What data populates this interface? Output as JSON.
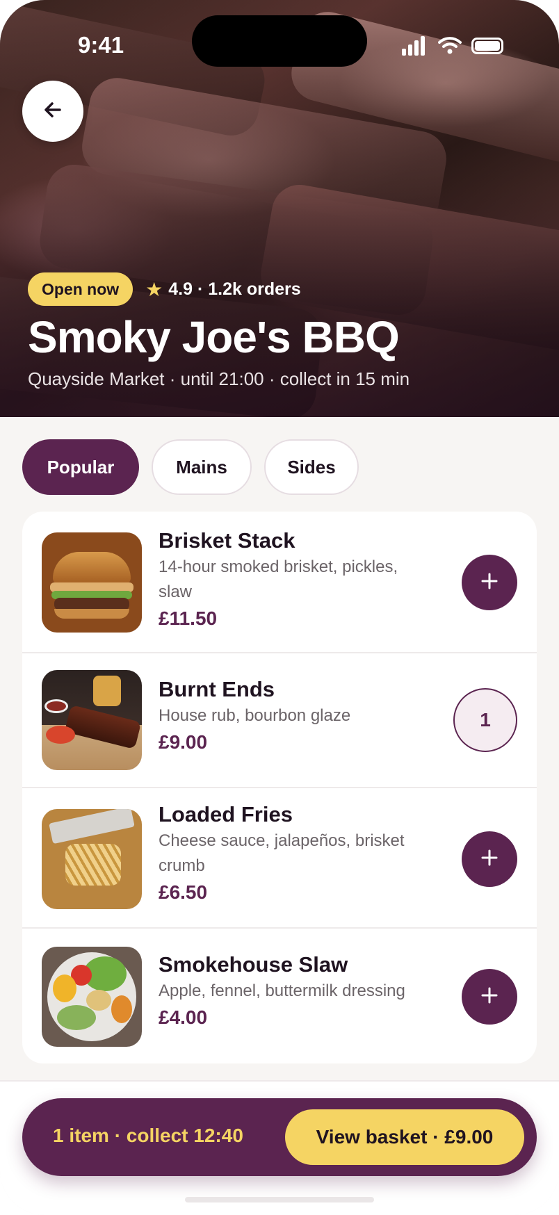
{
  "status_bar": {
    "time": "9:41"
  },
  "hero": {
    "badge": "Open now",
    "rating": "4.9 · 1.2k orders",
    "title": "Smoky Joe's BBQ",
    "subtitle": "Quayside Market · until 21:00 · collect in 15 min"
  },
  "tabs": [
    {
      "label": "Popular",
      "active": true
    },
    {
      "label": "Mains",
      "active": false
    },
    {
      "label": "Sides",
      "active": false
    }
  ],
  "menu_items": [
    {
      "name": "Brisket Stack",
      "desc_line1": "14-hour smoked brisket, pickles,",
      "desc_line2": "slaw",
      "price": "£11.50",
      "action": "add"
    },
    {
      "name": "Burnt Ends",
      "desc_line1": "House rub, bourbon glaze",
      "desc_line2": "",
      "price": "£9.00",
      "action": "quantity",
      "quantity": "1"
    },
    {
      "name": "Loaded Fries",
      "desc_line1": "Cheese sauce, jalapeños, brisket",
      "desc_line2": "crumb",
      "price": "£6.50",
      "action": "add"
    },
    {
      "name": "Smokehouse Slaw",
      "desc_line1": "Apple, fennel, buttermilk dressing",
      "desc_line2": "",
      "price": "£4.00",
      "action": "add"
    }
  ],
  "cart": {
    "summary": "1 item · collect 12:40",
    "button_label": "View basket · £9.00"
  },
  "colors": {
    "primary": "#5b2450",
    "accent": "#f5d463",
    "background": "#f7f5f3"
  }
}
